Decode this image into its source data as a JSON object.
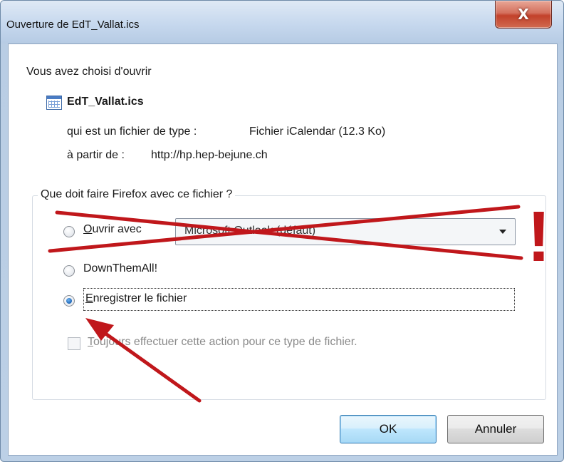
{
  "window": {
    "title": "Ouverture de EdT_Vallat.ics",
    "close_label": "X"
  },
  "intro": "Vous avez choisi d'ouvrir",
  "file": {
    "name": "EdT_Vallat.ics",
    "type_label": "qui est un fichier de type :",
    "type_value": "Fichier iCalendar (12.3 Ko)",
    "from_label": "à partir de :",
    "from_value": "http://hp.hep-bejune.ch"
  },
  "group": {
    "label": "Que doit faire Firefox avec ce fichier ?",
    "open_with": {
      "label": "Ouvrir avec",
      "accesskey": "O",
      "selected": false
    },
    "app_select": {
      "value": "Microsoft Outlook (défaut)"
    },
    "downthemall": {
      "label": "DownThemAll!",
      "selected": false
    },
    "save": {
      "label": "Enregistrer le fichier",
      "accesskey": "E",
      "selected": true
    },
    "always": {
      "label": "Toujours effectuer cette action pour ce type de fichier.",
      "accesskey": "T",
      "checked": false,
      "enabled": false
    }
  },
  "buttons": {
    "ok": "OK",
    "cancel": "Annuler"
  },
  "annotations": {
    "exclamation": "!",
    "color": "#c0171b"
  }
}
